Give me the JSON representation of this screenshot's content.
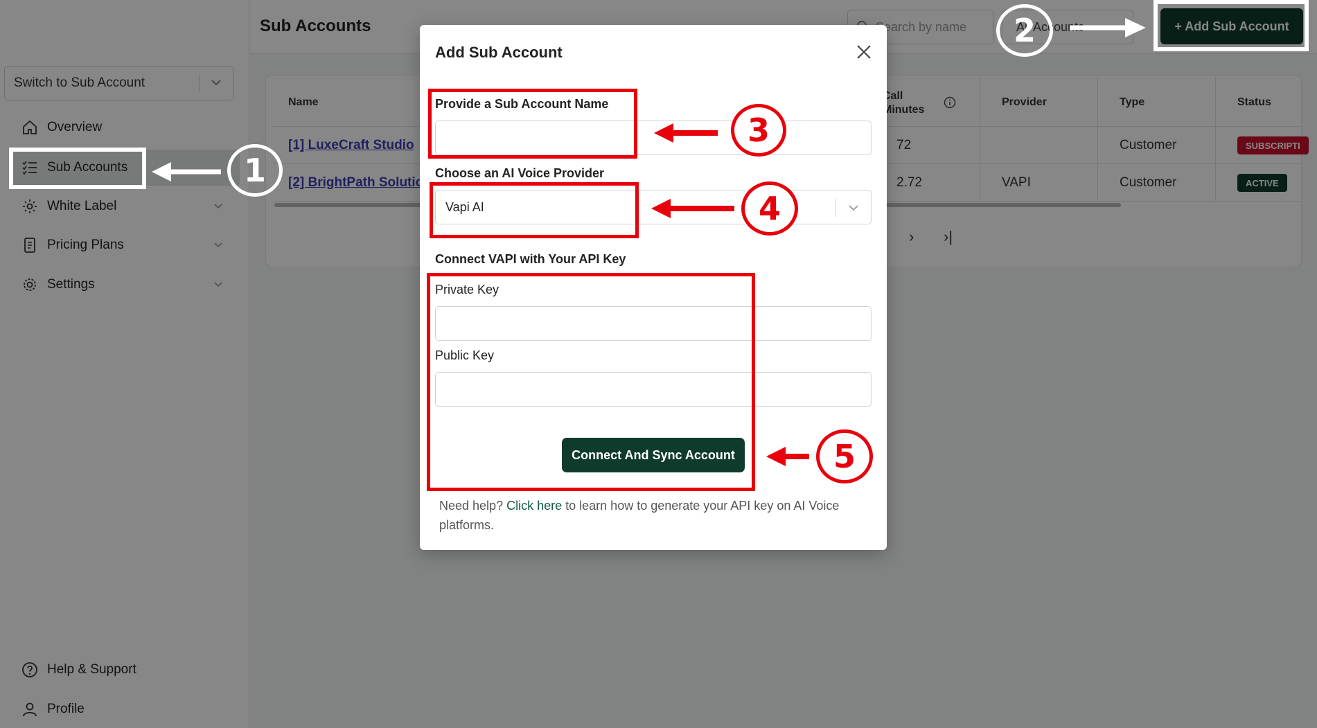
{
  "page": {
    "title": "Sub Accounts"
  },
  "sidebar": {
    "switch_select": {
      "label": "Switch to Sub Account"
    },
    "items": [
      {
        "label": "Overview",
        "icon": "home-icon"
      },
      {
        "label": "Sub Accounts",
        "icon": "list-check-icon"
      },
      {
        "label": "White Label",
        "icon": "gear-icon"
      },
      {
        "label": "Pricing Plans",
        "icon": "document-icon"
      },
      {
        "label": "Settings",
        "icon": "settings-icon"
      }
    ],
    "bottom_items": [
      {
        "label": "Help & Support",
        "icon": "help-icon"
      },
      {
        "label": "Profile",
        "icon": "user-icon"
      }
    ]
  },
  "header": {
    "search_placeholder": "Search by name",
    "filter_value": "All Accounts",
    "add_button": "+ Add Sub Account"
  },
  "table": {
    "columns": [
      "Name",
      "Call Minutes",
      "Provider",
      "Type",
      "Status"
    ],
    "rows": [
      {
        "name": "[1] LuxeCraft Studio",
        "minutes": "72",
        "provider": "",
        "type": "Customer",
        "status": "SUBSCRIPTI",
        "status_color": "#c8102e"
      },
      {
        "name": "[2] BrightPath Solutio",
        "minutes": "2.72",
        "provider": "VAPI",
        "type": "Customer",
        "status": "ACTIVE",
        "status_color": "#0f3b2c"
      }
    ],
    "pager": {
      "next": "›",
      "last": "›|"
    }
  },
  "modal": {
    "title": "Add Sub Account",
    "name_label": "Provide a Sub Account Name",
    "name_value": "",
    "provider_label": "Choose an AI Voice Provider",
    "provider_value": "Vapi AI",
    "connect_heading": "Connect VAPI with Your API Key",
    "private_key_label": "Private Key",
    "private_key_value": "",
    "public_key_label": "Public Key",
    "public_key_value": "",
    "connect_button": "Connect And Sync Account",
    "help_prefix": "Need help?",
    "help_link": "Click here",
    "help_suffix": "to learn how to generate your API key on AI Voice platforms."
  },
  "annotations": [
    {
      "number": "1"
    },
    {
      "number": "2"
    },
    {
      "number": "3"
    },
    {
      "number": "4"
    },
    {
      "number": "5"
    }
  ],
  "colors": {
    "brand": "#0f3b2c",
    "annotation_red": "#e8000b",
    "link": "#3d3db3"
  }
}
